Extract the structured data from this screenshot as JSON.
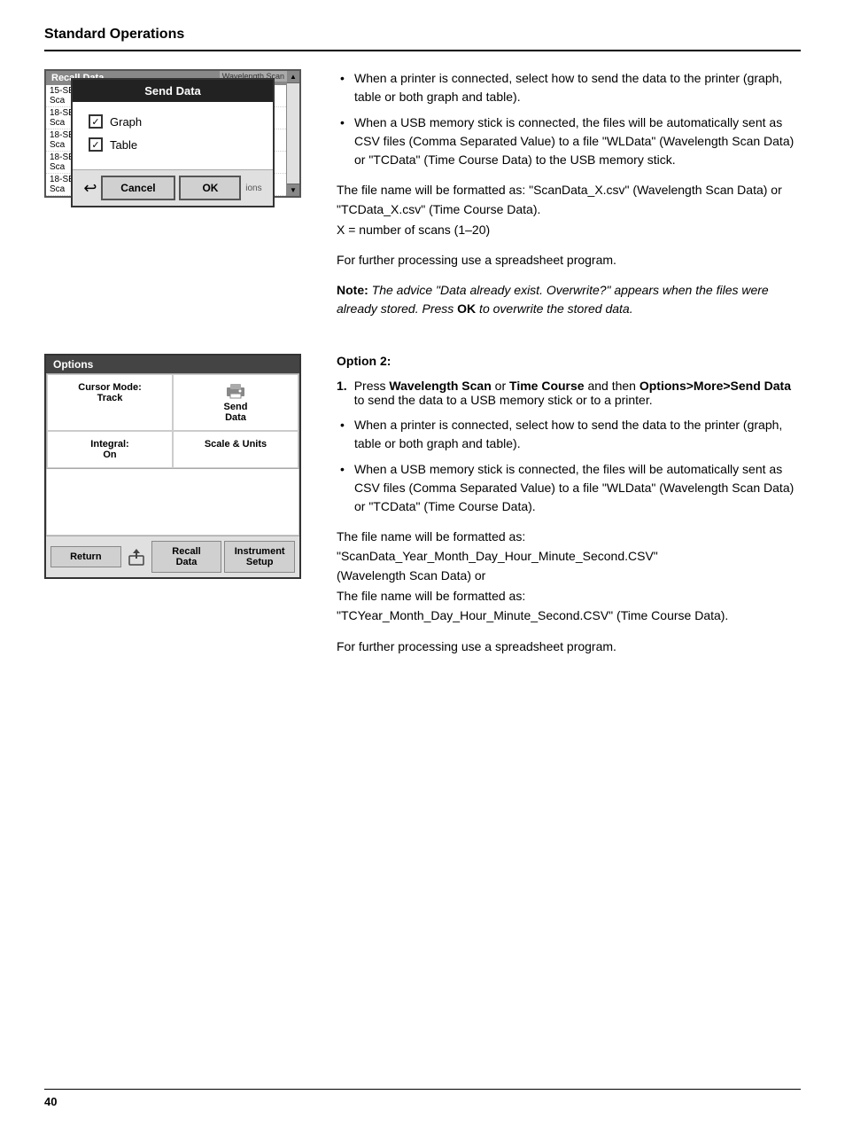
{
  "page": {
    "header_title": "Standard Operations",
    "footer_page": "40"
  },
  "dialog1": {
    "title": "Send Data",
    "recall_title": "Recall Data",
    "wl_scan_label": "Wavelength Scan",
    "list_items": [
      "15-SE\nSca",
      "18-SE\nSca",
      "18-SE\nSca",
      "18-SE\nSca",
      "18-SE\nSca"
    ],
    "checkbox1_label": "Graph",
    "checkbox2_label": "Table",
    "cancel_label": "Cancel",
    "ok_label": "OK"
  },
  "dialog2": {
    "options_label": "Options",
    "cursor_mode_label": "Cursor Mode:",
    "cursor_mode_value": "Track",
    "send_data_label": "Send\nData",
    "integral_label": "Integral:\nOn",
    "scale_units_label": "Scale & Units",
    "return_label": "Return",
    "recall_data_label": "Recall\nData",
    "instrument_setup_label": "Instrument\nSetup"
  },
  "right_col1": {
    "bullet1": "When a printer is connected, select how to send the data to the printer (graph, table or both graph and table).",
    "bullet2": "When a USB memory stick is connected, the files will be automatically sent as CSV files (Comma Separated Value) to a file \"WLData\" (Wavelength Scan Data) or \"TCData\" (Time Course Data) to the USB memory stick.",
    "para1": "The file name will be formatted as: \"ScanData_X.csv\" (Wavelength Scan Data) or \"TCData_X.csv\" (Time Course Data).\nX = number of scans (1–20)",
    "para2": "For further processing use a spreadsheet program.",
    "note": "Note: The advice \"Data already exist. Overwrite?\" appears when the files were already stored. Press OK to overwrite the stored data."
  },
  "right_col2": {
    "option2_title": "Option 2:",
    "step1_num": "1.",
    "step1_text": "Press Wavelength Scan or Time Course and then Options>More>Send Data to send the data to a USB memory stick or to a printer.",
    "step1_bold1": "Wavelength Scan",
    "step1_bold2": "Time Course",
    "step1_bold3": "Options>More>Send Data",
    "bullet1": "When a printer is connected, select how to send the data to the printer (graph, table or both graph and table).",
    "bullet2": "When a USB memory stick is connected, the files will be automatically sent as CSV files (Comma Separated Value) to a file \"WLData\" (Wavelength Scan Data) or \"TCData\" (Time Course Data).",
    "para1": "The file name will be formatted as:\n\"ScanData_Year_Month_Day_Hour_Minute_Second.CSV\"\n(Wavelength Scan Data) or\nThe file name will be formatted as:\n\"TCYear_Month_Day_Hour_Minute_Second.CSV\" (Time Course Data).",
    "para2": "For further processing use a spreadsheet program."
  }
}
